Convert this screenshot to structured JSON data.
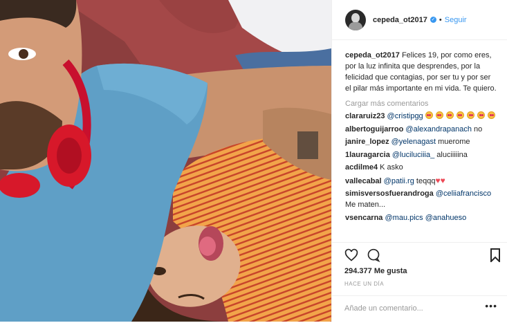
{
  "post": {
    "username": "cepeda_ot2017",
    "verified_icon": "verified-badge-icon",
    "separator": "•",
    "follow_label": "Seguir"
  },
  "caption": {
    "username": "cepeda_ot2017",
    "text": "Felices 19, por como eres, por la luz infinita que desprendes, por la felicidad que contagias, por ser tu y por ser el pilar más importante en mi vida. Te quiero."
  },
  "load_more": "Cargar más comentarios",
  "comments": [
    {
      "user": "clararuiz23",
      "mention": "@cristipgg",
      "text": "",
      "emoji": "heart-eyes-emoji",
      "emoji_count": 7
    },
    {
      "user": "albertoguijarroo",
      "mention": "@alexandrapanach",
      "text": "no"
    },
    {
      "user": "janire_lopez",
      "mention": "@yelenagast",
      "text": "muerome"
    },
    {
      "user": "1lauragarcia",
      "mention": "@luciluciiia_",
      "text": "aluciiiiina"
    },
    {
      "user": "acdilme4",
      "mention": "",
      "text": "K asko"
    },
    {
      "user": "vallecabal",
      "mention": "@patii.rg",
      "text": "teqqq",
      "heart_count": 2
    },
    {
      "user": "simisversosfuerandroga",
      "mention": "@celiiafrancisco",
      "text": "Me maten..."
    },
    {
      "user": "vsencarna",
      "mention": "@mau.pics @anahueso",
      "text": ""
    }
  ],
  "likes": "294.377 Me gusta",
  "timestamp": "HACE UN DÍA",
  "add_comment_placeholder": "Añade un comentario...",
  "colors": {
    "link": "#3897f0",
    "mention": "#003569",
    "muted": "#999999",
    "heart": "#ed4956"
  }
}
